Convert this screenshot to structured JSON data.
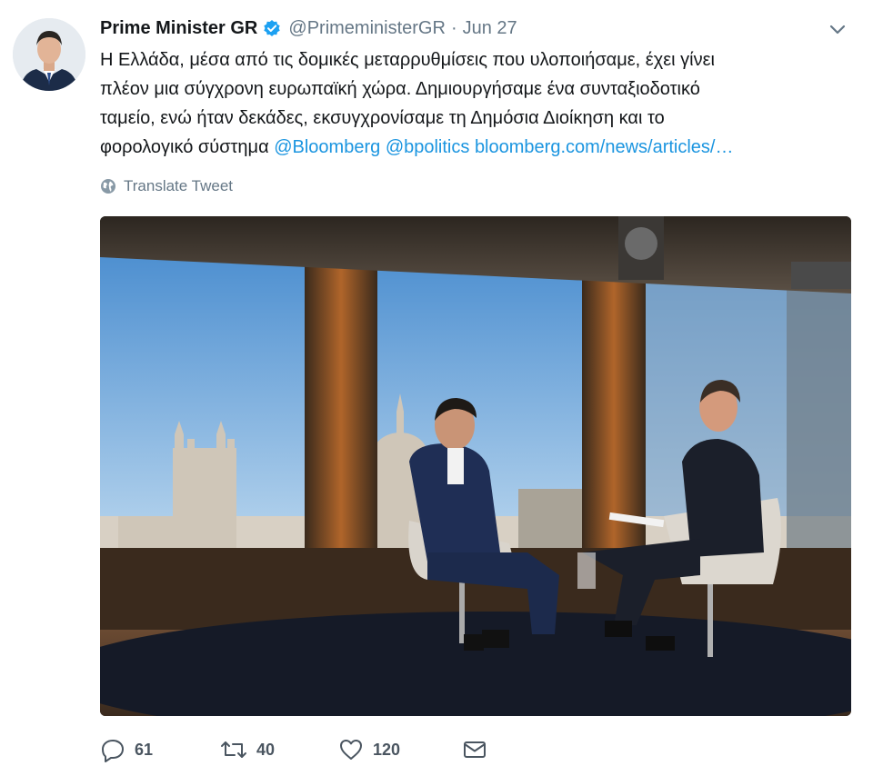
{
  "tweet": {
    "author": {
      "name": "Prime Minister GR",
      "handle": "@PrimeministerGR",
      "date": "Jun 27",
      "avatar_icon": "profile-photo",
      "verified_icon": "verified-badge-icon",
      "verified_color": "#1da1f2"
    },
    "text_lines": [
      "Η Ελλάδα, μέσα από τις δομικές μεταρρυθμίσεις που υλοποιήσαμε, έχει γίνει",
      "πλέον μια σύγχρονη ευρωπαϊκή χώρα. Δημιουργήσαμε ένα συνταξιοδοτικό",
      "ταμείο, ενώ ήταν δεκάδες, εκσυγχρονίσαμε τη Δημόσια Διοίκηση και το",
      "φορολογικό σύστημα"
    ],
    "mentions": [
      "@Bloomberg",
      "@bpolitics"
    ],
    "link": "bloomberg.com/news/articles/…",
    "link_color": "#1b95e0",
    "translate_label": "Translate Tweet",
    "translate_icon": "globe-icon",
    "menu_icon": "chevron-down-icon",
    "actions": {
      "replies": "61",
      "retweets": "40",
      "likes": "120",
      "reply_icon": "reply-icon",
      "retweet_icon": "retweet-icon",
      "like_icon": "heart-icon",
      "dm_icon": "envelope-icon"
    }
  }
}
